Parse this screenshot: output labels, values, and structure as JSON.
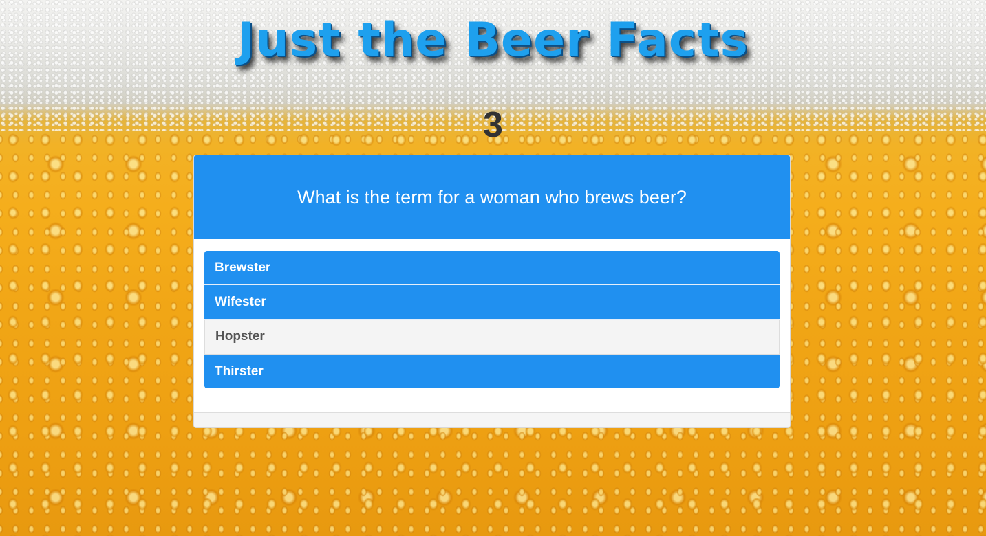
{
  "header": {
    "title": "Just the Beer Facts"
  },
  "quiz": {
    "counter": "3",
    "question": "What is the term for a woman who brews beer?",
    "answers": [
      {
        "label": "Brewster",
        "state": "default"
      },
      {
        "label": "Wifester",
        "state": "default"
      },
      {
        "label": "Hopster",
        "state": "selected"
      },
      {
        "label": "Thirster",
        "state": "default"
      }
    ]
  },
  "colors": {
    "primary_blue": "#2090f0",
    "title_blue": "#1ea0ee",
    "selected_bg": "#f4f4f4",
    "beer_gold": "#f2b226"
  }
}
